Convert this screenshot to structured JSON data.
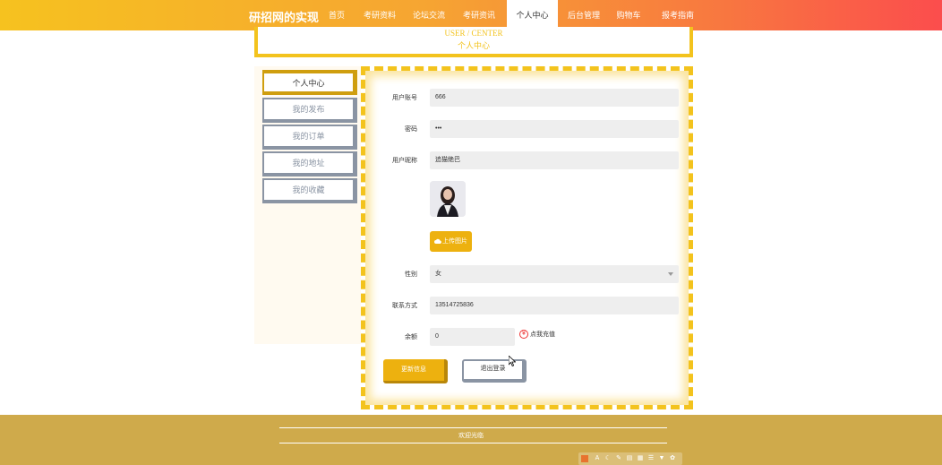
{
  "nav": {
    "brand": "研招网的实现",
    "items": [
      "首页",
      "考研资料",
      "论坛交流",
      "考研资讯",
      "个人中心",
      "后台管理",
      "购物车",
      "报考指南"
    ],
    "active_index": 4
  },
  "header": {
    "en": "USER / CENTER",
    "cn": "个人中心"
  },
  "sidebar": {
    "items": [
      "个人中心",
      "我的发布",
      "我的订单",
      "我的地址",
      "我的收藏"
    ],
    "active_index": 0
  },
  "form": {
    "account_label": "用户账号",
    "account_value": "666",
    "password_label": "密码",
    "password_value": "•••",
    "nickname_label": "用户昵称",
    "nickname_value": "追猫绝巴",
    "upload_label": "上传图片",
    "gender_label": "性别",
    "gender_value": "女",
    "phone_label": "联系方式",
    "phone_value": "13514725836",
    "balance_label": "余额",
    "balance_value": "0",
    "recharge_icon": "¥",
    "recharge_label": "点我充值",
    "update_button": "更新信息",
    "logout_button": "退出登录"
  },
  "footer": {
    "text": "欢迎光临"
  },
  "colors": {
    "accent": "#f3c31d",
    "button": "#edb10f",
    "footer": "#cfaa4b"
  }
}
